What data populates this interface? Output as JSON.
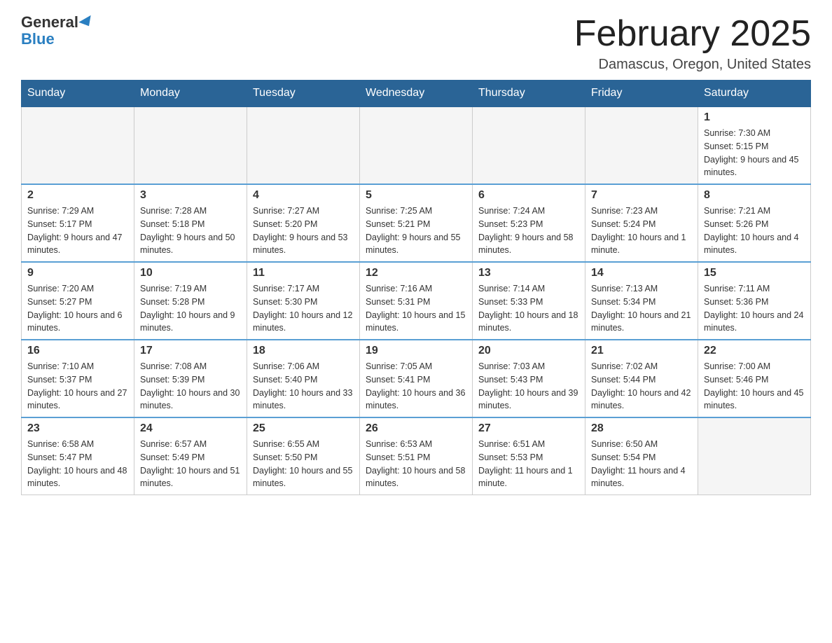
{
  "header": {
    "logo_general": "General",
    "logo_blue": "Blue",
    "title": "February 2025",
    "location": "Damascus, Oregon, United States"
  },
  "days_of_week": [
    "Sunday",
    "Monday",
    "Tuesday",
    "Wednesday",
    "Thursday",
    "Friday",
    "Saturday"
  ],
  "weeks": [
    [
      {
        "day": "",
        "info": ""
      },
      {
        "day": "",
        "info": ""
      },
      {
        "day": "",
        "info": ""
      },
      {
        "day": "",
        "info": ""
      },
      {
        "day": "",
        "info": ""
      },
      {
        "day": "",
        "info": ""
      },
      {
        "day": "1",
        "info": "Sunrise: 7:30 AM\nSunset: 5:15 PM\nDaylight: 9 hours and 45 minutes."
      }
    ],
    [
      {
        "day": "2",
        "info": "Sunrise: 7:29 AM\nSunset: 5:17 PM\nDaylight: 9 hours and 47 minutes."
      },
      {
        "day": "3",
        "info": "Sunrise: 7:28 AM\nSunset: 5:18 PM\nDaylight: 9 hours and 50 minutes."
      },
      {
        "day": "4",
        "info": "Sunrise: 7:27 AM\nSunset: 5:20 PM\nDaylight: 9 hours and 53 minutes."
      },
      {
        "day": "5",
        "info": "Sunrise: 7:25 AM\nSunset: 5:21 PM\nDaylight: 9 hours and 55 minutes."
      },
      {
        "day": "6",
        "info": "Sunrise: 7:24 AM\nSunset: 5:23 PM\nDaylight: 9 hours and 58 minutes."
      },
      {
        "day": "7",
        "info": "Sunrise: 7:23 AM\nSunset: 5:24 PM\nDaylight: 10 hours and 1 minute."
      },
      {
        "day": "8",
        "info": "Sunrise: 7:21 AM\nSunset: 5:26 PM\nDaylight: 10 hours and 4 minutes."
      }
    ],
    [
      {
        "day": "9",
        "info": "Sunrise: 7:20 AM\nSunset: 5:27 PM\nDaylight: 10 hours and 6 minutes."
      },
      {
        "day": "10",
        "info": "Sunrise: 7:19 AM\nSunset: 5:28 PM\nDaylight: 10 hours and 9 minutes."
      },
      {
        "day": "11",
        "info": "Sunrise: 7:17 AM\nSunset: 5:30 PM\nDaylight: 10 hours and 12 minutes."
      },
      {
        "day": "12",
        "info": "Sunrise: 7:16 AM\nSunset: 5:31 PM\nDaylight: 10 hours and 15 minutes."
      },
      {
        "day": "13",
        "info": "Sunrise: 7:14 AM\nSunset: 5:33 PM\nDaylight: 10 hours and 18 minutes."
      },
      {
        "day": "14",
        "info": "Sunrise: 7:13 AM\nSunset: 5:34 PM\nDaylight: 10 hours and 21 minutes."
      },
      {
        "day": "15",
        "info": "Sunrise: 7:11 AM\nSunset: 5:36 PM\nDaylight: 10 hours and 24 minutes."
      }
    ],
    [
      {
        "day": "16",
        "info": "Sunrise: 7:10 AM\nSunset: 5:37 PM\nDaylight: 10 hours and 27 minutes."
      },
      {
        "day": "17",
        "info": "Sunrise: 7:08 AM\nSunset: 5:39 PM\nDaylight: 10 hours and 30 minutes."
      },
      {
        "day": "18",
        "info": "Sunrise: 7:06 AM\nSunset: 5:40 PM\nDaylight: 10 hours and 33 minutes."
      },
      {
        "day": "19",
        "info": "Sunrise: 7:05 AM\nSunset: 5:41 PM\nDaylight: 10 hours and 36 minutes."
      },
      {
        "day": "20",
        "info": "Sunrise: 7:03 AM\nSunset: 5:43 PM\nDaylight: 10 hours and 39 minutes."
      },
      {
        "day": "21",
        "info": "Sunrise: 7:02 AM\nSunset: 5:44 PM\nDaylight: 10 hours and 42 minutes."
      },
      {
        "day": "22",
        "info": "Sunrise: 7:00 AM\nSunset: 5:46 PM\nDaylight: 10 hours and 45 minutes."
      }
    ],
    [
      {
        "day": "23",
        "info": "Sunrise: 6:58 AM\nSunset: 5:47 PM\nDaylight: 10 hours and 48 minutes."
      },
      {
        "day": "24",
        "info": "Sunrise: 6:57 AM\nSunset: 5:49 PM\nDaylight: 10 hours and 51 minutes."
      },
      {
        "day": "25",
        "info": "Sunrise: 6:55 AM\nSunset: 5:50 PM\nDaylight: 10 hours and 55 minutes."
      },
      {
        "day": "26",
        "info": "Sunrise: 6:53 AM\nSunset: 5:51 PM\nDaylight: 10 hours and 58 minutes."
      },
      {
        "day": "27",
        "info": "Sunrise: 6:51 AM\nSunset: 5:53 PM\nDaylight: 11 hours and 1 minute."
      },
      {
        "day": "28",
        "info": "Sunrise: 6:50 AM\nSunset: 5:54 PM\nDaylight: 11 hours and 4 minutes."
      },
      {
        "day": "",
        "info": ""
      }
    ]
  ]
}
